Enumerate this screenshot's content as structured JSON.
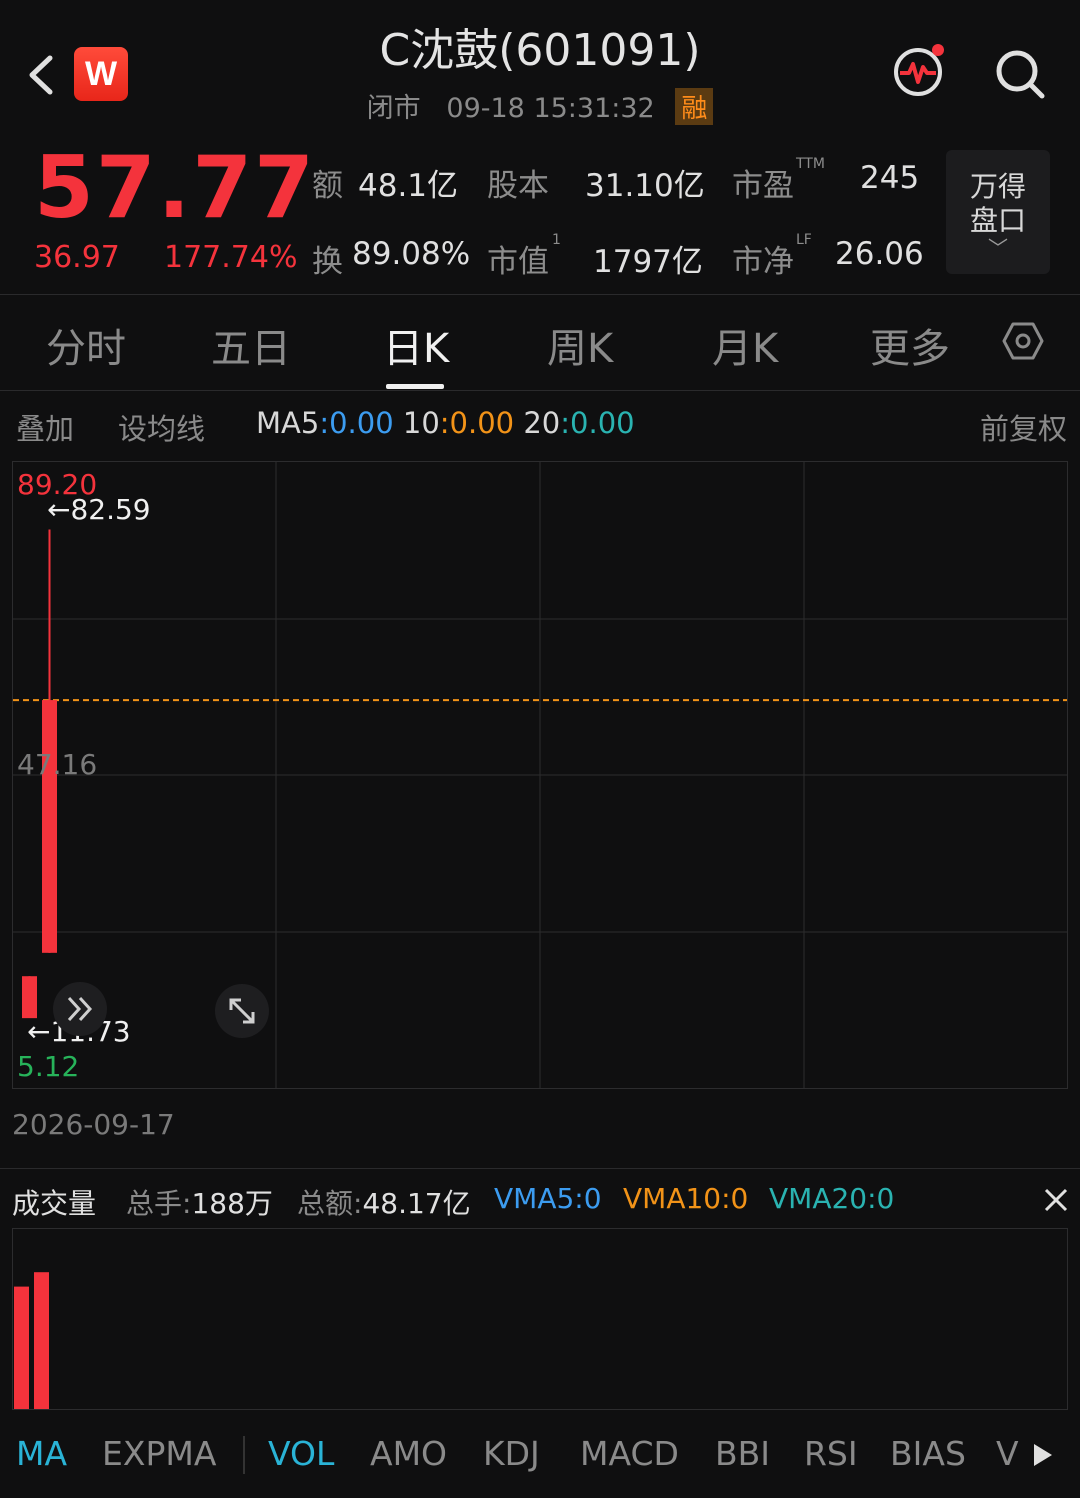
{
  "header": {
    "logo_text": "W",
    "title": "C沈鼓(601091)",
    "status": "闭市",
    "datetime": "09-18 15:31:32",
    "badge": "融"
  },
  "quote": {
    "price": "57.77",
    "change": "36.97",
    "change_pct": "177.74%",
    "stats": {
      "amount_label": "额",
      "amount_value": "48.1亿",
      "capital_label": "股本",
      "capital_value": "31.10亿",
      "pe_label": "市盈",
      "pe_sup": "TTM",
      "pe_value": "245",
      "turnover_label": "换",
      "turnover_value": "89.08%",
      "mcap_label": "市值",
      "mcap_sup": "1",
      "mcap_value": "1797亿",
      "pb_label": "市净",
      "pb_sup": "LF",
      "pb_value": "26.06"
    },
    "wande_line1": "万得",
    "wande_line2": "盘口",
    "wande_chevron": "﹀"
  },
  "tabs": [
    {
      "label": "分时"
    },
    {
      "label": "五日"
    },
    {
      "label": "日K"
    },
    {
      "label": "周K"
    },
    {
      "label": "月K"
    },
    {
      "label": "更多"
    }
  ],
  "active_tab": "日K",
  "toolbar": {
    "overlay": "叠加",
    "set_ma": "设均线",
    "ma5_label": "MA5",
    "ma5_value": ":0.00",
    "ma10_label": "10",
    "ma10_value": ":0.00",
    "ma20_label": "20",
    "ma20_value": ":0.00",
    "adjust": "前复权"
  },
  "chart_data": {
    "type": "candlestick",
    "y_max_label": "89.20",
    "y_mid_label": "47.16",
    "y_min_label": "5.12",
    "ylim": [
      5.12,
      89.2
    ],
    "high_marker": "←82.59",
    "low_marker": "←11.73",
    "reference_price": 57.77,
    "candles": [
      {
        "open": 11.5,
        "close": 17.6,
        "high": 17.6,
        "low": 11.73,
        "color": "#f4333c"
      },
      {
        "open": 21.0,
        "close": 57.77,
        "high": 82.59,
        "low": 21.0,
        "color": "#f4333c"
      }
    ],
    "x_label": "2026-09-17"
  },
  "volume": {
    "title": "成交量",
    "total_hands_label": "总手:",
    "total_hands_value": "188万",
    "total_amount_label": "总额:",
    "total_amount_value": "48.17亿",
    "vma5": "VMA5:0",
    "vma10": "VMA10:0",
    "vma20": "VMA20:0",
    "bars": [
      0.68,
      0.76
    ]
  },
  "indicators": [
    "MA",
    "EXPMA",
    "VOL",
    "AMO",
    "KDJ",
    "MACD",
    "BBI",
    "RSI",
    "BIAS",
    "V"
  ],
  "colors": {
    "up": "#f4333c",
    "down": "#27b35a",
    "ma5": "#3c9cf0",
    "ma10": "#f29318",
    "ma20": "#2ab3b1",
    "ref_line": "#f29318"
  }
}
